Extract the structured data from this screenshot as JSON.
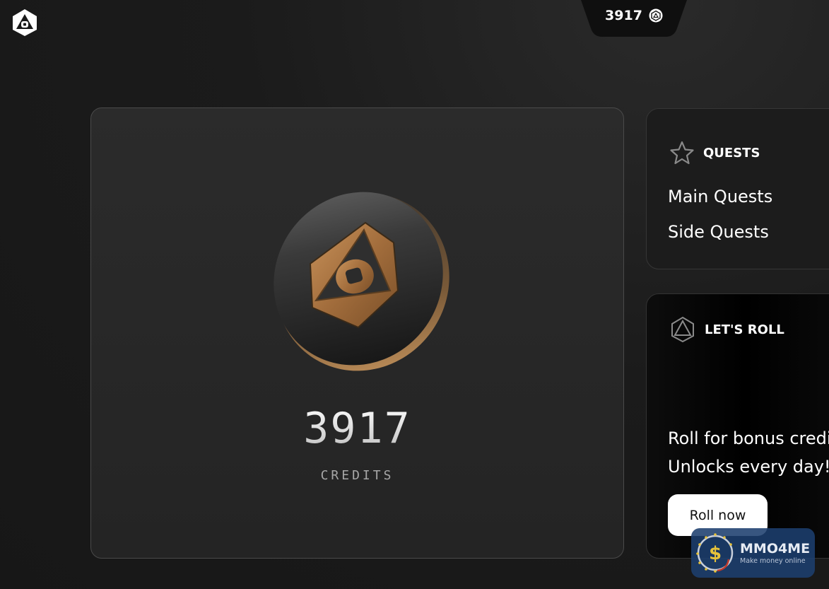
{
  "header": {
    "logo_icon": "hexagon-logo-icon",
    "credits_value": "3917",
    "credits_icon": "credit-coin-icon"
  },
  "main_card": {
    "coin_icon": "bronze-coin-icon",
    "credits_value": "3917",
    "credits_label": "CREDITS"
  },
  "quests": {
    "icon": "star-icon",
    "title": "QUESTS",
    "items": [
      {
        "label": "Main Quests"
      },
      {
        "label": "Side Quests"
      }
    ]
  },
  "roll": {
    "icon": "triangle-hexagon-icon",
    "title": "LET'S ROLL",
    "line1": "Roll for bonus credits!",
    "line2": "Unlocks every day!",
    "button_label": "Roll now"
  },
  "watermark": {
    "title": "MMO4ME",
    "subtitle": "Make money online"
  },
  "colors": {
    "background": "#1a1a1a",
    "card": "#2b2b2b",
    "accent_bronze": "#b5804c",
    "watermark_blue": "#1c3f6e"
  }
}
